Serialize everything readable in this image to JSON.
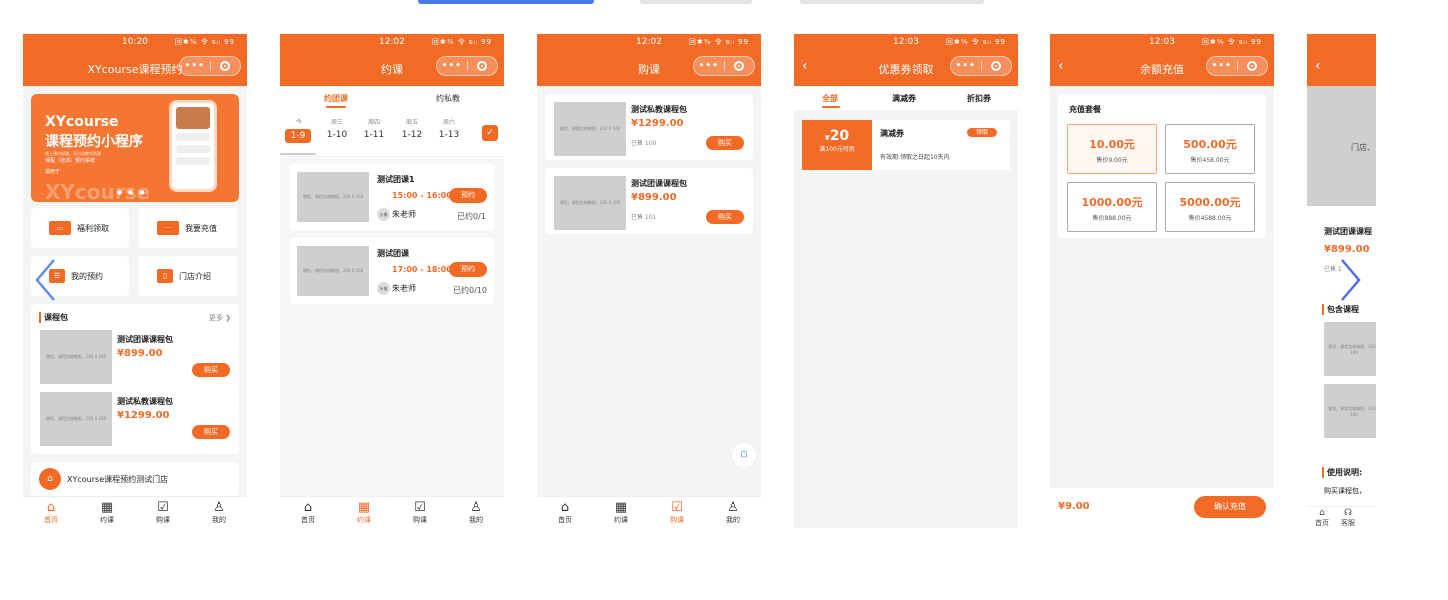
{
  "phones": {
    "home": {
      "time": "10:20",
      "title": "XYcourse课程预约",
      "banner": {
        "l1": "XYcourse",
        "l2": "课程预约小程序",
        "l3": "线上预约授课，不占用教学资源",
        "l4": "课程（培训）预约系统",
        "l5": "适用于",
        "l6": "XYcourse"
      },
      "quick": [
        "福利领取",
        "我要充值",
        "我的预约",
        "门店介绍"
      ],
      "section": "课程包",
      "more": "更多",
      "packages": [
        {
          "name": "测试团课课程包",
          "price": "¥899.00",
          "btn": "购买"
        },
        {
          "name": "测试私教课程包",
          "price": "¥1299.00",
          "btn": "购买"
        }
      ],
      "store": "XYcourse课程预约测试门店",
      "placeholder": "课程，课程包缩略图，240 X 160"
    },
    "schedule": {
      "time": "12:02",
      "title": "约课",
      "tabs": [
        "约团课",
        "约私教"
      ],
      "days": [
        {
          "d": "今",
          "date": "1-9"
        },
        {
          "d": "周三",
          "date": "1-10"
        },
        {
          "d": "周四",
          "date": "1-11"
        },
        {
          "d": "周五",
          "date": "1-12"
        },
        {
          "d": "周六",
          "date": "1-13"
        }
      ],
      "classes": [
        {
          "name": "测试团课1",
          "time": "15:00 - 16:00",
          "btn": "预约",
          "teacher": "朱老师",
          "booked": "已约0/1"
        },
        {
          "name": "测试团课",
          "time": "17:00 - 18:00",
          "btn": "预约",
          "teacher": "朱老师",
          "booked": "已约0/10"
        }
      ],
      "avatar": "头像"
    },
    "purchase": {
      "time": "12:02",
      "title": "购课",
      "items": [
        {
          "name": "测试私教课程包",
          "price": "¥1299.00",
          "sold": "已售 100",
          "btn": "购买"
        },
        {
          "name": "测试团课课程包",
          "price": "¥899.00",
          "sold": "已售 101",
          "btn": "购买"
        }
      ]
    },
    "coupon": {
      "time": "12:03",
      "title": "优惠券领取",
      "tabs": [
        "全部",
        "满减券",
        "折扣券"
      ],
      "coupon": {
        "amount": "20",
        "currency": "¥",
        "cond": "满100元可用",
        "type": "满减券",
        "valid": "有效期:领取之日起10天内",
        "btn": "领取"
      }
    },
    "recharge": {
      "time": "12:03",
      "title": "余额充值",
      "section": "充值套餐",
      "options": [
        {
          "amount": "10.00元",
          "sale": "售价9.00元"
        },
        {
          "amount": "500.00元",
          "sale": "售价458.00元"
        },
        {
          "amount": "1000.00元",
          "sale": "售价888.00元"
        },
        {
          "amount": "5000.00元",
          "sale": "售价4588.00元"
        }
      ],
      "total": "¥9.00",
      "confirm": "确认充值"
    },
    "detail": {
      "banner_text": "门店、",
      "name": "测试团课课程",
      "price": "¥899.00",
      "sold": "已售 1",
      "section": "包含课程",
      "usage": "使用说明:",
      "usage_text": "购买课程包，",
      "tabs": [
        "首页",
        "客服"
      ]
    }
  },
  "tabbar": {
    "home": "首页",
    "book": "约课",
    "buy": "购课",
    "mine": "我的"
  },
  "status_icons": "回✱⅜ 令 ᵴᵢₗ 99"
}
